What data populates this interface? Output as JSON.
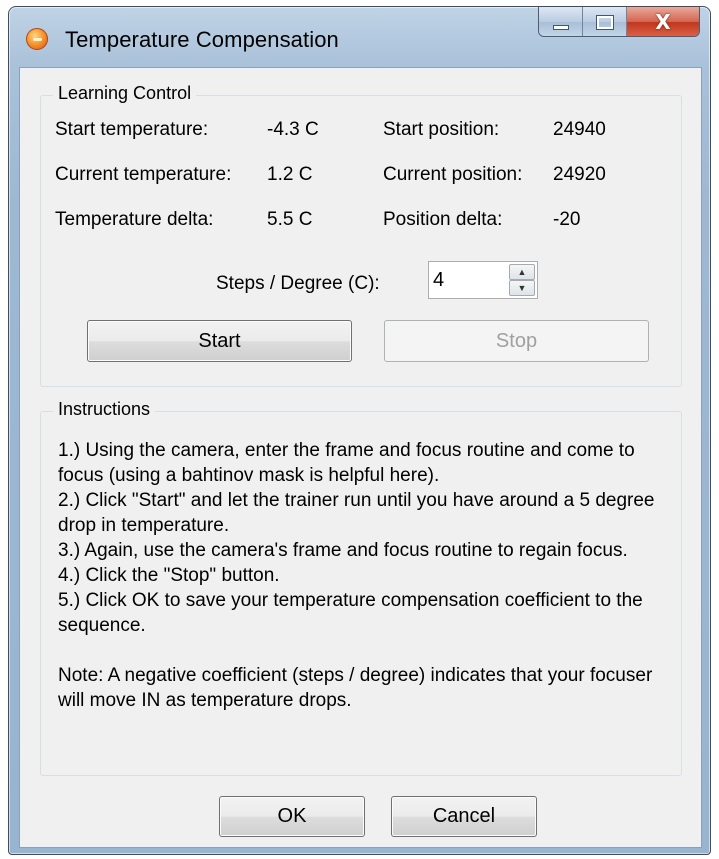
{
  "window": {
    "title": "Temperature Compensation",
    "controls": {
      "minimize_icon": "minimize-icon",
      "maximize_icon": "maximize-icon",
      "close_glyph": "X"
    }
  },
  "learning": {
    "legend": "Learning Control",
    "start_temp_label": "Start temperature:",
    "start_temp_value": "-4.3 C",
    "current_temp_label": "Current temperature:",
    "current_temp_value": "1.2 C",
    "temp_delta_label": "Temperature delta:",
    "temp_delta_value": "5.5 C",
    "start_pos_label": "Start position:",
    "start_pos_value": "24940",
    "current_pos_label": "Current position:",
    "current_pos_value": "24920",
    "pos_delta_label": "Position delta:",
    "pos_delta_value": "-20",
    "steps_label": "Steps / Degree (C):",
    "steps_value": "4",
    "start_button": "Start",
    "stop_button": "Stop"
  },
  "instructions": {
    "legend": "Instructions",
    "lines": [
      "1.) Using the camera, enter the frame and focus routine and come to focus (using a bahtinov mask is helpful here).",
      "2.) Click \"Start\" and let the trainer run until you have around a 5 degree drop in temperature.",
      "3.) Again, use the camera's frame and focus routine to regain focus.",
      "4.) Click the \"Stop\" button.",
      "5.) Click OK to save your temperature compensation coefficient to the sequence."
    ],
    "note": "Note: A negative coefficient (steps / degree) indicates that your focuser will move IN as temperature drops."
  },
  "footer": {
    "ok_button": "OK",
    "cancel_button": "Cancel"
  },
  "colors": {
    "title_frame": "#a9c1d9",
    "client_bg": "#f0f0f0",
    "close_button": "#c2361c"
  }
}
